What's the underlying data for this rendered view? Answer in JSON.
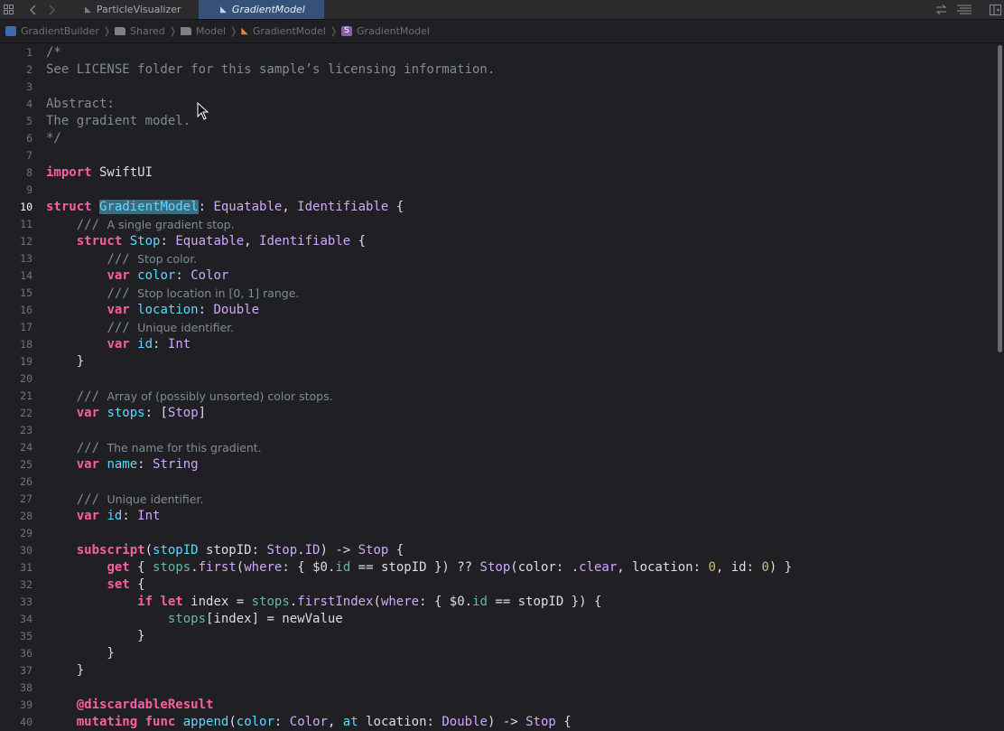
{
  "tabs": [
    {
      "label": "ParticleVisualizer",
      "active": false
    },
    {
      "label": "GradientModel",
      "active": true
    }
  ],
  "toolbar_icons": [
    "grid-icon",
    "back-arrow-icon",
    "forward-arrow-icon",
    "swap-icon",
    "lines-icon",
    "sidebar-icon"
  ],
  "breadcrumbs": [
    "GradientBuilder",
    "Shared",
    "Model",
    "GradientModel",
    "GradientModel"
  ],
  "current_line": 10,
  "lines": [
    {
      "n": 1,
      "segs": [
        {
          "c": "cmt",
          "t": "/*"
        }
      ]
    },
    {
      "n": 2,
      "segs": [
        {
          "c": "cmt",
          "t": "See LICENSE folder for this sample’s licensing information."
        }
      ]
    },
    {
      "n": 3,
      "segs": []
    },
    {
      "n": 4,
      "segs": [
        {
          "c": "cmt",
          "t": "Abstract:"
        }
      ]
    },
    {
      "n": 5,
      "segs": [
        {
          "c": "cmt",
          "t": "The gradient model."
        }
      ]
    },
    {
      "n": 6,
      "segs": [
        {
          "c": "cmt",
          "t": "*/"
        }
      ]
    },
    {
      "n": 7,
      "segs": []
    },
    {
      "n": 8,
      "segs": [
        {
          "c": "kw",
          "t": "import"
        },
        {
          "c": "",
          "t": " SwiftUI"
        }
      ]
    },
    {
      "n": 9,
      "segs": []
    },
    {
      "n": 10,
      "segs": [
        {
          "c": "kw",
          "t": "struct"
        },
        {
          "c": "",
          "t": " "
        },
        {
          "c": "decl hl",
          "t": "GradientModel"
        },
        {
          "c": "",
          "t": ": "
        },
        {
          "c": "type",
          "t": "Equatable"
        },
        {
          "c": "",
          "t": ", "
        },
        {
          "c": "type",
          "t": "Identifiable"
        },
        {
          "c": "",
          "t": " {"
        }
      ]
    },
    {
      "n": 11,
      "segs": [
        {
          "c": "",
          "t": "    "
        },
        {
          "c": "cmt",
          "t": "/// "
        },
        {
          "c": "doc",
          "t": "A single gradient stop."
        }
      ]
    },
    {
      "n": 12,
      "segs": [
        {
          "c": "",
          "t": "    "
        },
        {
          "c": "kw",
          "t": "struct"
        },
        {
          "c": "",
          "t": " "
        },
        {
          "c": "decl",
          "t": "Stop"
        },
        {
          "c": "",
          "t": ": "
        },
        {
          "c": "type",
          "t": "Equatable"
        },
        {
          "c": "",
          "t": ", "
        },
        {
          "c": "type",
          "t": "Identifiable"
        },
        {
          "c": "",
          "t": " {"
        }
      ]
    },
    {
      "n": 13,
      "segs": [
        {
          "c": "",
          "t": "        "
        },
        {
          "c": "cmt",
          "t": "/// "
        },
        {
          "c": "doc",
          "t": "Stop color."
        }
      ]
    },
    {
      "n": 14,
      "segs": [
        {
          "c": "",
          "t": "        "
        },
        {
          "c": "kw",
          "t": "var"
        },
        {
          "c": "",
          "t": " "
        },
        {
          "c": "decl",
          "t": "color"
        },
        {
          "c": "",
          "t": ": "
        },
        {
          "c": "type",
          "t": "Color"
        }
      ]
    },
    {
      "n": 15,
      "segs": [
        {
          "c": "",
          "t": "        "
        },
        {
          "c": "cmt",
          "t": "/// "
        },
        {
          "c": "doc",
          "t": "Stop location in [0, 1] range."
        }
      ]
    },
    {
      "n": 16,
      "segs": [
        {
          "c": "",
          "t": "        "
        },
        {
          "c": "kw",
          "t": "var"
        },
        {
          "c": "",
          "t": " "
        },
        {
          "c": "decl",
          "t": "location"
        },
        {
          "c": "",
          "t": ": "
        },
        {
          "c": "type",
          "t": "Double"
        }
      ]
    },
    {
      "n": 17,
      "segs": [
        {
          "c": "",
          "t": "        "
        },
        {
          "c": "cmt",
          "t": "/// "
        },
        {
          "c": "doc",
          "t": "Unique identifier."
        }
      ]
    },
    {
      "n": 18,
      "segs": [
        {
          "c": "",
          "t": "        "
        },
        {
          "c": "kw",
          "t": "var"
        },
        {
          "c": "",
          "t": " "
        },
        {
          "c": "decl",
          "t": "id"
        },
        {
          "c": "",
          "t": ": "
        },
        {
          "c": "type",
          "t": "Int"
        }
      ]
    },
    {
      "n": 19,
      "segs": [
        {
          "c": "",
          "t": "    }"
        }
      ]
    },
    {
      "n": 20,
      "segs": []
    },
    {
      "n": 21,
      "segs": [
        {
          "c": "",
          "t": "    "
        },
        {
          "c": "cmt",
          "t": "/// "
        },
        {
          "c": "doc",
          "t": "Array of (possibly unsorted) color stops."
        }
      ]
    },
    {
      "n": 22,
      "segs": [
        {
          "c": "",
          "t": "    "
        },
        {
          "c": "kw",
          "t": "var"
        },
        {
          "c": "",
          "t": " "
        },
        {
          "c": "decl",
          "t": "stops"
        },
        {
          "c": "",
          "t": ": ["
        },
        {
          "c": "type",
          "t": "Stop"
        },
        {
          "c": "",
          "t": "]"
        }
      ]
    },
    {
      "n": 23,
      "segs": []
    },
    {
      "n": 24,
      "segs": [
        {
          "c": "",
          "t": "    "
        },
        {
          "c": "cmt",
          "t": "/// "
        },
        {
          "c": "doc",
          "t": "The name for this gradient."
        }
      ]
    },
    {
      "n": 25,
      "segs": [
        {
          "c": "",
          "t": "    "
        },
        {
          "c": "kw",
          "t": "var"
        },
        {
          "c": "",
          "t": " "
        },
        {
          "c": "decl",
          "t": "name"
        },
        {
          "c": "",
          "t": ": "
        },
        {
          "c": "type",
          "t": "String"
        }
      ]
    },
    {
      "n": 26,
      "segs": []
    },
    {
      "n": 27,
      "segs": [
        {
          "c": "",
          "t": "    "
        },
        {
          "c": "cmt",
          "t": "/// "
        },
        {
          "c": "doc",
          "t": "Unique identifier."
        }
      ]
    },
    {
      "n": 28,
      "segs": [
        {
          "c": "",
          "t": "    "
        },
        {
          "c": "kw",
          "t": "var"
        },
        {
          "c": "",
          "t": " "
        },
        {
          "c": "decl",
          "t": "id"
        },
        {
          "c": "",
          "t": ": "
        },
        {
          "c": "type",
          "t": "Int"
        }
      ]
    },
    {
      "n": 29,
      "segs": []
    },
    {
      "n": 30,
      "segs": [
        {
          "c": "",
          "t": "    "
        },
        {
          "c": "kw",
          "t": "subscript"
        },
        {
          "c": "",
          "t": "("
        },
        {
          "c": "decl",
          "t": "stopID"
        },
        {
          "c": "",
          "t": " stopID: "
        },
        {
          "c": "type",
          "t": "Stop"
        },
        {
          "c": "",
          "t": "."
        },
        {
          "c": "type",
          "t": "ID"
        },
        {
          "c": "",
          "t": ") -> "
        },
        {
          "c": "type",
          "t": "Stop"
        },
        {
          "c": "",
          "t": " {"
        }
      ]
    },
    {
      "n": 31,
      "segs": [
        {
          "c": "",
          "t": "        "
        },
        {
          "c": "kw",
          "t": "get"
        },
        {
          "c": "",
          "t": " { "
        },
        {
          "c": "prop",
          "t": "stops"
        },
        {
          "c": "",
          "t": "."
        },
        {
          "c": "type",
          "t": "first"
        },
        {
          "c": "",
          "t": "("
        },
        {
          "c": "type",
          "t": "where"
        },
        {
          "c": "",
          "t": ": { $0."
        },
        {
          "c": "prop",
          "t": "id"
        },
        {
          "c": "",
          "t": " == stopID }) ?? "
        },
        {
          "c": "type",
          "t": "Stop"
        },
        {
          "c": "",
          "t": "(color: ."
        },
        {
          "c": "type",
          "t": "clear"
        },
        {
          "c": "",
          "t": ", location: "
        },
        {
          "c": "num",
          "t": "0"
        },
        {
          "c": "",
          "t": ", id: "
        },
        {
          "c": "num",
          "t": "0"
        },
        {
          "c": "",
          "t": ") }"
        }
      ]
    },
    {
      "n": 32,
      "segs": [
        {
          "c": "",
          "t": "        "
        },
        {
          "c": "kw",
          "t": "set"
        },
        {
          "c": "",
          "t": " {"
        }
      ]
    },
    {
      "n": 33,
      "segs": [
        {
          "c": "",
          "t": "            "
        },
        {
          "c": "kw",
          "t": "if"
        },
        {
          "c": "",
          "t": " "
        },
        {
          "c": "kw",
          "t": "let"
        },
        {
          "c": "",
          "t": " index = "
        },
        {
          "c": "prop",
          "t": "stops"
        },
        {
          "c": "",
          "t": "."
        },
        {
          "c": "type",
          "t": "firstIndex"
        },
        {
          "c": "",
          "t": "("
        },
        {
          "c": "type",
          "t": "where"
        },
        {
          "c": "",
          "t": ": { $0."
        },
        {
          "c": "prop",
          "t": "id"
        },
        {
          "c": "",
          "t": " == stopID }) {"
        }
      ]
    },
    {
      "n": 34,
      "segs": [
        {
          "c": "",
          "t": "                "
        },
        {
          "c": "prop",
          "t": "stops"
        },
        {
          "c": "",
          "t": "[index] = newValue"
        }
      ]
    },
    {
      "n": 35,
      "segs": [
        {
          "c": "",
          "t": "            }"
        }
      ]
    },
    {
      "n": 36,
      "segs": [
        {
          "c": "",
          "t": "        }"
        }
      ]
    },
    {
      "n": 37,
      "segs": [
        {
          "c": "",
          "t": "    }"
        }
      ]
    },
    {
      "n": 38,
      "segs": []
    },
    {
      "n": 39,
      "segs": [
        {
          "c": "",
          "t": "    "
        },
        {
          "c": "kw",
          "t": "@discardableResult"
        }
      ]
    },
    {
      "n": 40,
      "segs": [
        {
          "c": "",
          "t": "    "
        },
        {
          "c": "kw",
          "t": "mutating"
        },
        {
          "c": "",
          "t": " "
        },
        {
          "c": "kw",
          "t": "func"
        },
        {
          "c": "",
          "t": " "
        },
        {
          "c": "decl",
          "t": "append"
        },
        {
          "c": "",
          "t": "("
        },
        {
          "c": "decl",
          "t": "color"
        },
        {
          "c": "",
          "t": ": "
        },
        {
          "c": "type",
          "t": "Color"
        },
        {
          "c": "",
          "t": ", "
        },
        {
          "c": "decl",
          "t": "at"
        },
        {
          "c": "",
          "t": " location: "
        },
        {
          "c": "type",
          "t": "Double"
        },
        {
          "c": "",
          "t": ") -> "
        },
        {
          "c": "type",
          "t": "Stop"
        },
        {
          "c": "",
          "t": " {"
        }
      ]
    }
  ]
}
